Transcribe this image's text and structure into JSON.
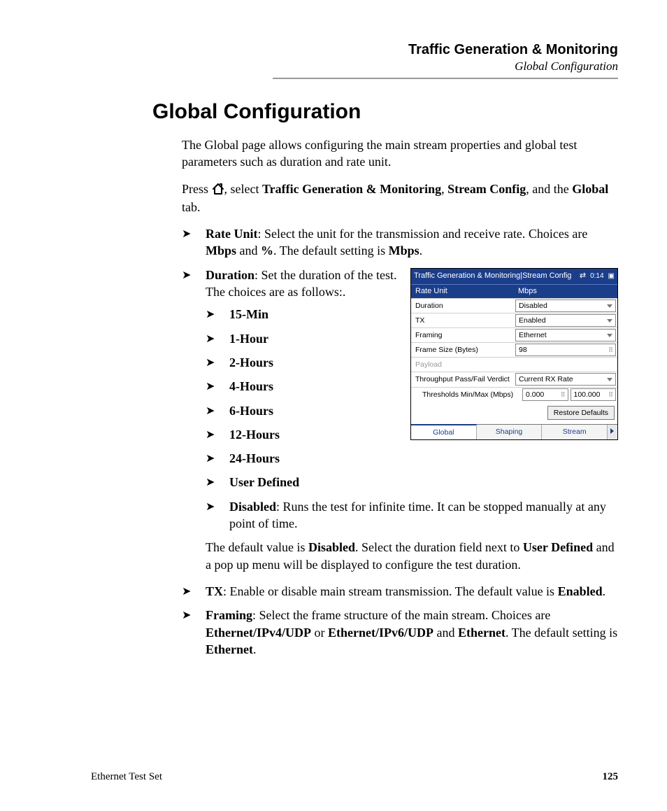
{
  "header": {
    "chapter": "Traffic Generation & Monitoring",
    "section": "Global Configuration"
  },
  "title": "Global Configuration",
  "intro": "The Global page allows configuring the main stream properties and global test parameters such as duration and rate unit.",
  "press": {
    "pre": "Press ",
    "post1": ", select ",
    "b1": "Traffic Generation & Monitoring",
    "sep1": ", ",
    "b2": "Stream Config",
    "post2": ", and the ",
    "b3": "Global",
    "post3": " tab."
  },
  "items": {
    "rateUnit": {
      "label": "Rate Unit",
      "text1": ": Select the unit for the transmission and receive rate. Choices are ",
      "b1": "Mbps",
      "text2": " and ",
      "b2": "%",
      "text3": ". The default setting is ",
      "b3": "Mbps",
      "text4": "."
    },
    "duration": {
      "label": "Duration",
      "text": ": Set the duration of the test. The choices are as follows:.",
      "choices": [
        "15-Min",
        "1-Hour",
        "2-Hours",
        "4-Hours",
        "6-Hours",
        "12-Hours",
        "24-Hours",
        "User Defined"
      ],
      "disabled_label": "Disabled",
      "disabled_text": ": Runs the test for infinite time. It can be stopped manually at any point of time.",
      "default1": "The default value is ",
      "default_b1": "Disabled",
      "default2": ". Select the duration field next to ",
      "default_b2": "User Defined",
      "default3": " and a pop up menu will be displayed to configure the test duration."
    },
    "tx": {
      "label": "TX",
      "text1": ": Enable or disable main stream transmission. The default value is ",
      "b1": "Enabled",
      "text2": "."
    },
    "framing": {
      "label": "Framing",
      "text1": ": Select the frame structure of the main stream. Choices are ",
      "b1": "Ethernet/IPv4/UDP",
      "text2": " or ",
      "b2": "Ethernet/IPv6/UDP",
      "text3": " and ",
      "b3": "Ethernet",
      "text4": ". The default setting is ",
      "b4": "Ethernet",
      "text5": "."
    }
  },
  "ui": {
    "title": "Traffic Generation & Monitoring|Stream Config",
    "time": "0:14",
    "head_l": "Rate Unit",
    "head_r": "Mbps",
    "rows": {
      "duration_l": "Duration",
      "duration_v": "Disabled",
      "tx_l": "TX",
      "tx_v": "Enabled",
      "framing_l": "Framing",
      "framing_v": "Ethernet",
      "fs_l": "Frame Size (Bytes)",
      "fs_v": "98",
      "payload_l": "Payload",
      "verdict_l": "Throughput Pass/Fail Verdict",
      "verdict_v": "Current RX Rate",
      "thr_l": "Thresholds Min/Max (Mbps)",
      "thr_min": "0.000",
      "thr_max": "100.000"
    },
    "restore": "Restore Defaults",
    "tabs": {
      "global": "Global",
      "shaping": "Shaping",
      "stream": "Stream"
    }
  },
  "footer": {
    "left": "Ethernet Test Set",
    "page": "125"
  }
}
